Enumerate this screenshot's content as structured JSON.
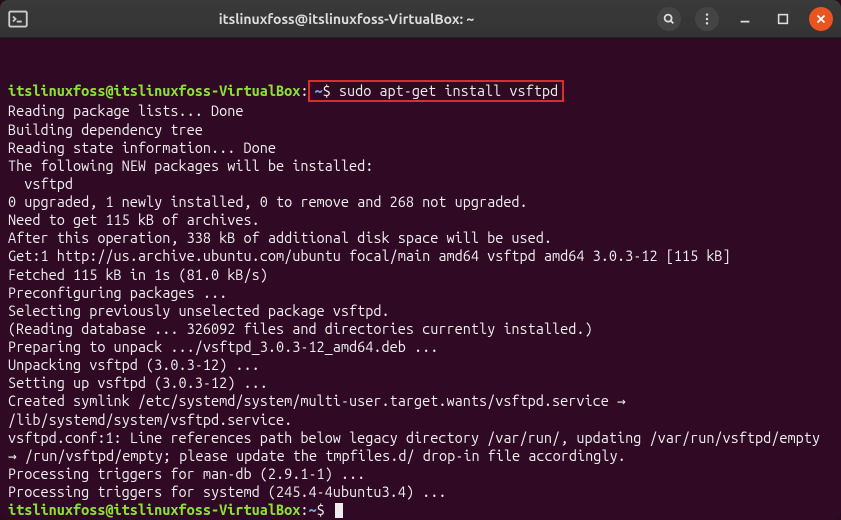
{
  "window": {
    "title": "itslinuxfoss@itslinuxfoss-VirtualBox: ~"
  },
  "prompt1": {
    "user_host": "itslinuxfoss@itslinuxfoss-VirtualBox",
    "colon": ":",
    "path": "~",
    "dollar": "$ ",
    "command": "sudo apt-get install vsftpd"
  },
  "output": [
    "Reading package lists... Done",
    "Building dependency tree",
    "Reading state information... Done",
    "The following NEW packages will be installed:",
    "  vsftpd",
    "0 upgraded, 1 newly installed, 0 to remove and 268 not upgraded.",
    "Need to get 115 kB of archives.",
    "After this operation, 338 kB of additional disk space will be used.",
    "Get:1 http://us.archive.ubuntu.com/ubuntu focal/main amd64 vsftpd amd64 3.0.3-12 [115 kB]",
    "Fetched 115 kB in 1s (81.0 kB/s)",
    "Preconfiguring packages ...",
    "Selecting previously unselected package vsftpd.",
    "(Reading database ... 326092 files and directories currently installed.)",
    "Preparing to unpack .../vsftpd_3.0.3-12_amd64.deb ...",
    "Unpacking vsftpd (3.0.3-12) ...",
    "Setting up vsftpd (3.0.3-12) ...",
    "Created symlink /etc/systemd/system/multi-user.target.wants/vsftpd.service → /lib/systemd/system/vsftpd.service.",
    "vsftpd.conf:1: Line references path below legacy directory /var/run/, updating /var/run/vsftpd/empty → /run/vsftpd/empty; please update the tmpfiles.d/ drop-in file accordingly.",
    "Processing triggers for man-db (2.9.1-1) ...",
    "Processing triggers for systemd (245.4-4ubuntu3.4) ..."
  ],
  "prompt2": {
    "user_host": "itslinuxfoss@itslinuxfoss-VirtualBox",
    "colon": ":",
    "path": "~",
    "dollar": "$ "
  }
}
